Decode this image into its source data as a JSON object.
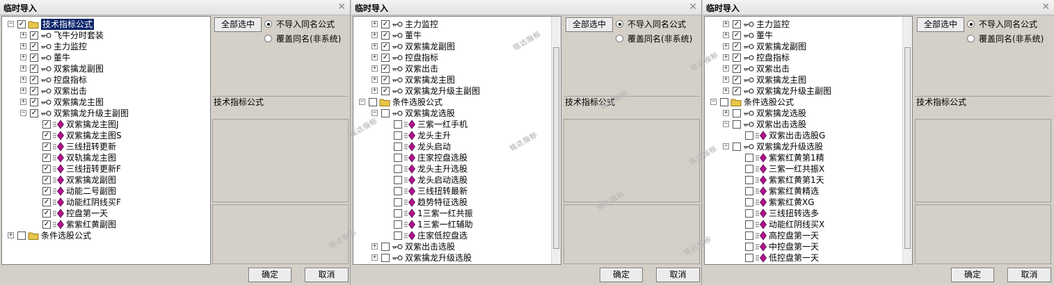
{
  "panels": [
    {
      "title": "临时导入",
      "select_all_label": "全部选中",
      "radio_no_import": "不导入同名公式",
      "radio_overwrite": "覆盖同名(非系统)",
      "info_label": "技术指标公式",
      "ok_label": "确定",
      "cancel_label": "取消",
      "tree": [
        {
          "level": 0,
          "toggle": "minus",
          "checked": true,
          "icon": "folder-icon",
          "label": "技术指标公式",
          "selected": true
        },
        {
          "level": 1,
          "toggle": "plus",
          "checked": true,
          "icon": "key-icon",
          "label": "飞牛分时套装"
        },
        {
          "level": 1,
          "toggle": "plus",
          "checked": true,
          "icon": "key-icon",
          "label": "主力监控"
        },
        {
          "level": 1,
          "toggle": "plus",
          "checked": true,
          "icon": "key-icon",
          "label": "董牛"
        },
        {
          "level": 1,
          "toggle": "plus",
          "checked": true,
          "icon": "key-icon",
          "label": "双紫擒龙副图"
        },
        {
          "level": 1,
          "toggle": "plus",
          "checked": true,
          "icon": "key-icon",
          "label": "控盘指标"
        },
        {
          "level": 1,
          "toggle": "plus",
          "checked": true,
          "icon": "key-icon",
          "label": "双紫出击"
        },
        {
          "level": 1,
          "toggle": "plus",
          "checked": true,
          "icon": "key-icon",
          "label": "双紫擒龙主图"
        },
        {
          "level": 1,
          "toggle": "minus",
          "checked": true,
          "icon": "key-icon",
          "label": "双紫擒龙升级主副图"
        },
        {
          "level": 2,
          "toggle": "",
          "checked": true,
          "icon": "formula-icon",
          "label": "双紫擒龙主图J"
        },
        {
          "level": 2,
          "toggle": "",
          "checked": true,
          "icon": "formula-icon",
          "label": "双紫擒龙主图S"
        },
        {
          "level": 2,
          "toggle": "",
          "checked": true,
          "icon": "formula-icon",
          "label": "三线扭转更新"
        },
        {
          "level": 2,
          "toggle": "",
          "checked": true,
          "icon": "formula-icon",
          "label": "双轨擒龙主图"
        },
        {
          "level": 2,
          "toggle": "",
          "checked": true,
          "icon": "formula-icon",
          "label": "三线扭转更新F"
        },
        {
          "level": 2,
          "toggle": "",
          "checked": true,
          "icon": "formula-icon",
          "label": "双紫擒龙副图"
        },
        {
          "level": 2,
          "toggle": "",
          "checked": true,
          "icon": "formula-icon",
          "label": "动能二号副图"
        },
        {
          "level": 2,
          "toggle": "",
          "checked": true,
          "icon": "formula-icon",
          "label": "动能红阴线买F"
        },
        {
          "level": 2,
          "toggle": "",
          "checked": true,
          "icon": "formula-icon",
          "label": "控盘第一天"
        },
        {
          "level": 2,
          "toggle": "",
          "checked": true,
          "icon": "formula-icon",
          "label": "紫紫红黄副图"
        },
        {
          "level": 0,
          "toggle": "plus",
          "checked": false,
          "icon": "folder-icon",
          "label": "条件选股公式"
        }
      ]
    },
    {
      "title": "临时导入",
      "select_all_label": "全部选中",
      "radio_no_import": "不导入同名公式",
      "radio_overwrite": "覆盖同名(非系统)",
      "info_label": "技术指标公式",
      "ok_label": "确定",
      "cancel_label": "取消",
      "tree": [
        {
          "level": 1,
          "toggle": "plus",
          "checked": true,
          "icon": "key-icon",
          "label": "主力监控"
        },
        {
          "level": 1,
          "toggle": "plus",
          "checked": true,
          "icon": "key-icon",
          "label": "董牛"
        },
        {
          "level": 1,
          "toggle": "plus",
          "checked": true,
          "icon": "key-icon",
          "label": "双紫擒龙副图"
        },
        {
          "level": 1,
          "toggle": "plus",
          "checked": true,
          "icon": "key-icon",
          "label": "控盘指标"
        },
        {
          "level": 1,
          "toggle": "plus",
          "checked": true,
          "icon": "key-icon",
          "label": "双紫出击"
        },
        {
          "level": 1,
          "toggle": "plus",
          "checked": true,
          "icon": "key-icon",
          "label": "双紫擒龙主图"
        },
        {
          "level": 1,
          "toggle": "plus",
          "checked": true,
          "icon": "key-icon",
          "label": "双紫擒龙升级主副图"
        },
        {
          "level": 0,
          "toggle": "minus",
          "checked": false,
          "icon": "folder-icon",
          "label": "条件选股公式"
        },
        {
          "level": 1,
          "toggle": "minus",
          "checked": false,
          "icon": "key-icon",
          "label": "双紫擒龙选股"
        },
        {
          "level": 2,
          "toggle": "",
          "checked": false,
          "icon": "formula-icon",
          "label": "三紫一红手机"
        },
        {
          "level": 2,
          "toggle": "",
          "checked": false,
          "icon": "formula-icon",
          "label": "龙头主升"
        },
        {
          "level": 2,
          "toggle": "",
          "checked": false,
          "icon": "formula-icon",
          "label": "龙头启动"
        },
        {
          "level": 2,
          "toggle": "",
          "checked": false,
          "icon": "formula-icon",
          "label": "庄家控盘选股"
        },
        {
          "level": 2,
          "toggle": "",
          "checked": false,
          "icon": "formula-icon",
          "label": "龙头主升选股"
        },
        {
          "level": 2,
          "toggle": "",
          "checked": false,
          "icon": "formula-icon",
          "label": "龙头启动选股"
        },
        {
          "level": 2,
          "toggle": "",
          "checked": false,
          "icon": "formula-icon",
          "label": "三线扭转最新"
        },
        {
          "level": 2,
          "toggle": "",
          "checked": false,
          "icon": "formula-icon",
          "label": "趋势特征选股"
        },
        {
          "level": 2,
          "toggle": "",
          "checked": false,
          "icon": "formula-icon",
          "label": "1三紫一红共振"
        },
        {
          "level": 2,
          "toggle": "",
          "checked": false,
          "icon": "formula-icon",
          "label": "1三紫一红辅助"
        },
        {
          "level": 2,
          "toggle": "",
          "checked": false,
          "icon": "formula-icon",
          "label": "庄家低控盘选"
        },
        {
          "level": 1,
          "toggle": "plus",
          "checked": false,
          "icon": "key-icon",
          "label": "双紫出击选股"
        },
        {
          "level": 1,
          "toggle": "plus",
          "checked": false,
          "icon": "key-icon",
          "label": "双紫擒龙升级选股"
        }
      ]
    },
    {
      "title": "临时导入",
      "select_all_label": "全部选中",
      "radio_no_import": "不导入同名公式",
      "radio_overwrite": "覆盖同名(非系统)",
      "info_label": "技术指标公式",
      "ok_label": "确定",
      "cancel_label": "取消",
      "tree": [
        {
          "level": 1,
          "toggle": "plus",
          "checked": true,
          "icon": "key-icon",
          "label": "主力监控"
        },
        {
          "level": 1,
          "toggle": "plus",
          "checked": true,
          "icon": "key-icon",
          "label": "董牛"
        },
        {
          "level": 1,
          "toggle": "plus",
          "checked": true,
          "icon": "key-icon",
          "label": "双紫擒龙副图"
        },
        {
          "level": 1,
          "toggle": "plus",
          "checked": true,
          "icon": "key-icon",
          "label": "控盘指标"
        },
        {
          "level": 1,
          "toggle": "plus",
          "checked": true,
          "icon": "key-icon",
          "label": "双紫出击"
        },
        {
          "level": 1,
          "toggle": "plus",
          "checked": true,
          "icon": "key-icon",
          "label": "双紫擒龙主图"
        },
        {
          "level": 1,
          "toggle": "plus",
          "checked": true,
          "icon": "key-icon",
          "label": "双紫擒龙升级主副图"
        },
        {
          "level": 0,
          "toggle": "minus",
          "checked": false,
          "icon": "folder-icon",
          "label": "条件选股公式"
        },
        {
          "level": 1,
          "toggle": "plus",
          "checked": false,
          "icon": "key-icon",
          "label": "双紫擒龙选股"
        },
        {
          "level": 1,
          "toggle": "minus",
          "checked": false,
          "icon": "key-icon",
          "label": "双紫出击选股"
        },
        {
          "level": 2,
          "toggle": "",
          "checked": false,
          "icon": "formula-icon",
          "label": "双紫出击选股G"
        },
        {
          "level": 1,
          "toggle": "minus",
          "checked": false,
          "icon": "key-icon",
          "label": "双紫擒龙升级选股"
        },
        {
          "level": 2,
          "toggle": "",
          "checked": false,
          "icon": "formula-icon",
          "label": "紫紫红黄第1精"
        },
        {
          "level": 2,
          "toggle": "",
          "checked": false,
          "icon": "formula-icon",
          "label": "三紫一红共振X"
        },
        {
          "level": 2,
          "toggle": "",
          "checked": false,
          "icon": "formula-icon",
          "label": "紫紫红黄第1天"
        },
        {
          "level": 2,
          "toggle": "",
          "checked": false,
          "icon": "formula-icon",
          "label": "紫紫红黄精选"
        },
        {
          "level": 2,
          "toggle": "",
          "checked": false,
          "icon": "formula-icon",
          "label": "紫紫红黄XG"
        },
        {
          "level": 2,
          "toggle": "",
          "checked": false,
          "icon": "formula-icon",
          "label": "三线扭转选多"
        },
        {
          "level": 2,
          "toggle": "",
          "checked": false,
          "icon": "formula-icon",
          "label": "动能红阴线买X"
        },
        {
          "level": 2,
          "toggle": "",
          "checked": false,
          "icon": "formula-icon",
          "label": "高控盘第一天"
        },
        {
          "level": 2,
          "toggle": "",
          "checked": false,
          "icon": "formula-icon",
          "label": "中控盘第一天"
        },
        {
          "level": 2,
          "toggle": "",
          "checked": false,
          "icon": "formula-icon",
          "label": "低控盘第一天"
        }
      ]
    }
  ],
  "watermark": "铭达指标",
  "colors": {
    "selection": "#0a246a",
    "formula_diamond": "#b0148c",
    "folder": "#e8c54a",
    "window_bg": "#d4d0c8"
  }
}
